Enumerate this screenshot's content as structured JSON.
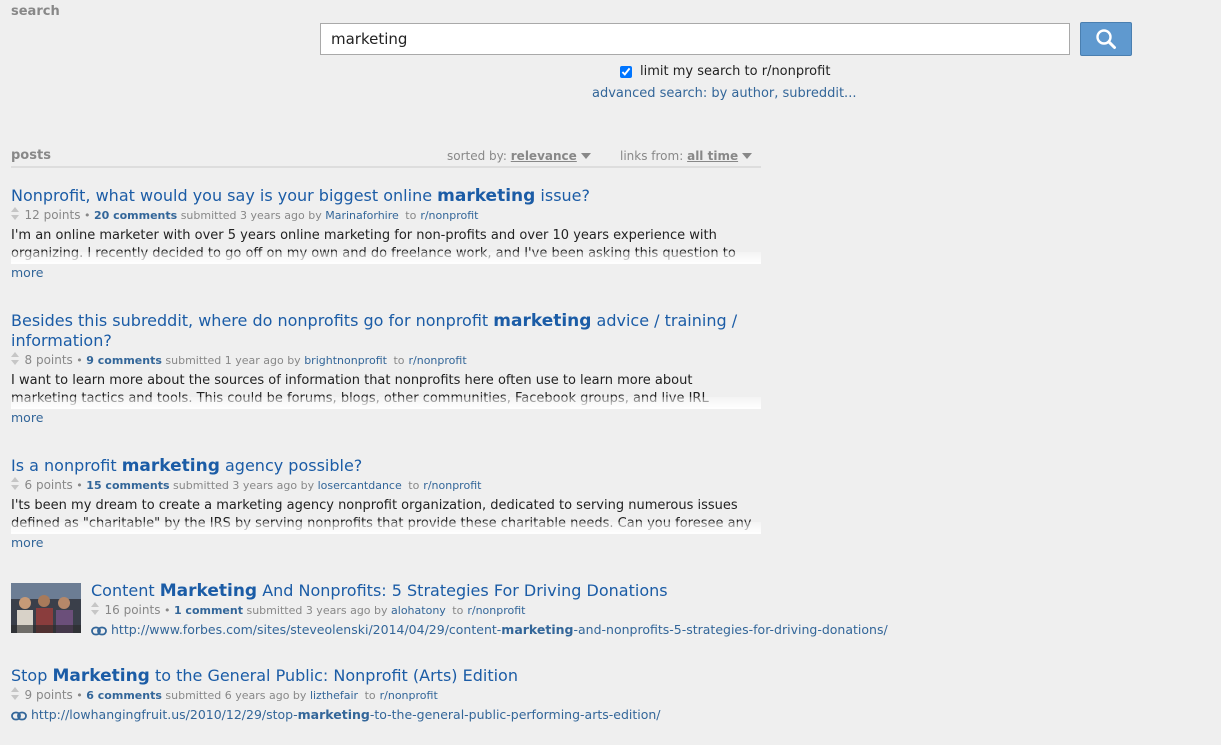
{
  "search": {
    "heading": "search",
    "query": "marketing",
    "restrict_label": "limit my search to r/nonprofit",
    "advanced_link": "advanced search: by author, subreddit..."
  },
  "posts_menu": {
    "heading": "posts",
    "sorted_by_label": "sorted by:",
    "sorted_by_value": "relevance",
    "links_from_label": "links from:",
    "links_from_value": "all time"
  },
  "results": [
    {
      "title_before": "Nonprofit, what would you say is your biggest online ",
      "title_hl": "marketing",
      "title_after": " issue?",
      "points": "12 points",
      "comments": "20 comments",
      "submitted": "submitted 3 years ago by",
      "author": "Marinaforhire",
      "to": "to",
      "subreddit": "r/nonprofit",
      "body": "I'm an online marketer with over 5 years online marketing for non-profits and over 10 years experience with organizing. I recently decided to go off on my own and do freelance work, and I've been asking this question to nonprofits everywhere I go about what their biggest issues are.",
      "more": "more"
    },
    {
      "title_before": "Besides this subreddit, where do nonprofits go for nonprofit ",
      "title_hl": "marketing",
      "title_after": " advice / training / information?",
      "points": "8 points",
      "comments": "9 comments",
      "submitted": "submitted 1 year ago by",
      "author": "brightnonprofit",
      "to": "to",
      "subreddit": "r/nonprofit",
      "body": "I want to learn more about the sources of information that nonprofits here often use to learn more about marketing tactics and tools. This could be forums, blogs, other communities, Facebook groups, and live IRL events/trainings.",
      "more": "more"
    },
    {
      "title_before": "Is a nonprofit ",
      "title_hl": "marketing",
      "title_after": " agency possible?",
      "points": "6 points",
      "comments": "15 comments",
      "submitted": "submitted 3 years ago by",
      "author": "losercantdance",
      "to": "to",
      "subreddit": "r/nonprofit",
      "body": "I'ts been my dream to create a marketing agency nonprofit organization, dedicated to serving numerous issues defined as \"charitable\" by the IRS by serving nonprofits that provide these charitable needs. Can you foresee any difficulties in this venture? The agency would serve nonprofits at low or no cost.",
      "more": "more"
    },
    {
      "title_before": "Content ",
      "title_hl": "Marketing",
      "title_after": " And Nonprofits: 5 Strategies For Driving Donations",
      "points": "16 points",
      "comments": "1 comment",
      "submitted": "submitted 3 years ago by",
      "author": "alohatony",
      "to": "to",
      "subreddit": "r/nonprofit",
      "url_before": "http://www.forbes.com/sites/steveolenski/2014/04/29/content-",
      "url_hl": "marketing",
      "url_after": "-and-nonprofits-5-strategies-for-driving-donations/"
    },
    {
      "title_before": "Stop ",
      "title_hl": "Marketing",
      "title_after": " to the General Public: Nonprofit (Arts) Edition",
      "points": "9 points",
      "comments": "6 comments",
      "submitted": "submitted 6 years ago by",
      "author": "lizthefair",
      "to": "to",
      "subreddit": "r/nonprofit",
      "url_before": "http://lowhangingfruit.us/2010/12/29/stop-",
      "url_hl": "marketing",
      "url_after": "-to-the-general-public-performing-arts-edition/"
    }
  ],
  "colors": {
    "link": "#1b5ca6",
    "button": "#5f99cf",
    "background": "#efefef"
  },
  "icons": [
    "search-icon",
    "vote-arrows-icon",
    "link-icon",
    "dropdown-arrow-icon"
  ]
}
